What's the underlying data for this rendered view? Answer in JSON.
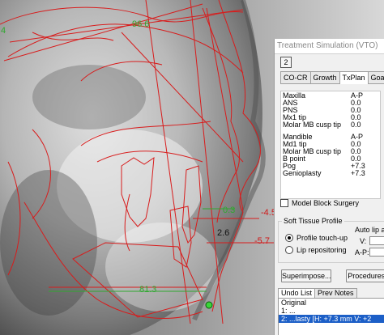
{
  "measurements": {
    "left_edge": "4",
    "angle_top": "96.6",
    "soft_tissue_value": "0.3",
    "lip_value": "2.6",
    "right_value_1": "-4.5",
    "right_value_2": "-5.7",
    "chin_value": "81.3"
  },
  "panel": {
    "title": "Treatment Simulation (VTO)",
    "number_button": "2",
    "tabs": [
      {
        "label": "CO-CR",
        "active": false
      },
      {
        "label": "Growth",
        "active": false
      },
      {
        "label": "TxPlan",
        "active": true
      },
      {
        "label": "Goal",
        "active": false
      }
    ],
    "maxilla": {
      "header": "Maxilla",
      "col": "A-P",
      "rows": [
        {
          "label": "ANS",
          "value": "0.0"
        },
        {
          "label": "PNS",
          "value": "0.0"
        },
        {
          "label": "Mx1 tip",
          "value": "0.0"
        },
        {
          "label": "Molar MB cusp tip",
          "value": "0.0"
        }
      ]
    },
    "mandible": {
      "header": "Mandible",
      "col": "A-P",
      "rows": [
        {
          "label": "Md1 tip",
          "value": "0.0"
        },
        {
          "label": "Molar MB cusp tip",
          "value": "0.0"
        },
        {
          "label": "B point",
          "value": "0.0"
        },
        {
          "label": "Pog",
          "value": "+7.3"
        },
        {
          "label": "Genioplasty",
          "value": "+7.3"
        }
      ]
    },
    "model_block": "Model Block Surgery",
    "soft_tissue": {
      "title": "Soft Tissue Profile",
      "option1": "Profile touch-up",
      "option2": "Lip repositoring",
      "auto_label": "Auto lip a",
      "v_label": "V:",
      "ap_label": "A-P:"
    },
    "superimpose": "Superimpose...",
    "procedures": "Procedures...",
    "undo_tabs": [
      "Undo List",
      "Prev Notes"
    ],
    "undo_items": [
      "Original",
      "1: ...",
      "2: ...lasty [H: +7.3 mm V: +2"
    ]
  }
}
